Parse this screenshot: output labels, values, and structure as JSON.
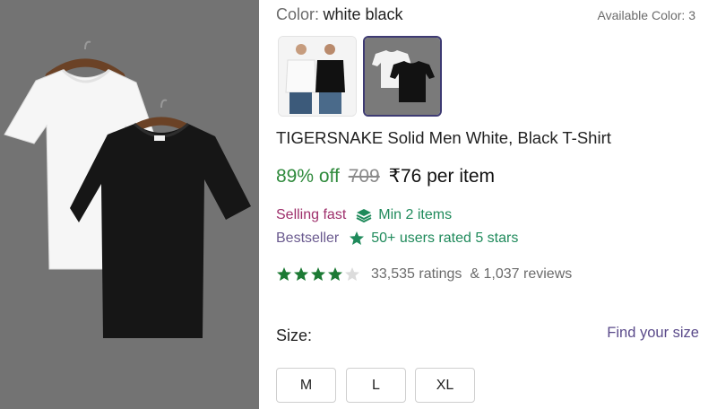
{
  "product": {
    "color_label": "Color:",
    "color_value": "white black",
    "available_colors": "Available Color: 3",
    "title": "TIGERSNAKE Solid Men White, Black T-Shirt",
    "discount": "89% off",
    "mrp": "709",
    "price": "₹76 per item",
    "selling_fast": "Selling fast",
    "min_items": "Min 2 items",
    "bestseller": "Bestseller",
    "users_rated": "50+ users rated 5 stars",
    "rating_value": 4,
    "rating_max": 5,
    "ratings_count": "33,535 ratings",
    "reviews_count": "& 1,037 reviews"
  },
  "size": {
    "label": "Size:",
    "find_link": "Find your size",
    "options": [
      "M",
      "L",
      "XL"
    ]
  },
  "colors": {
    "discount_green": "#2f8a3c",
    "selling_pink": "#9e2f6b",
    "bestseller_purple": "#6a5a8f",
    "badge_green": "#1f8a5b",
    "link_purple": "#5a4a8a",
    "star_green": "#1c7a34",
    "selected_border": "#3e3b73"
  },
  "icons": {
    "min_items": "stack-layers-icon",
    "users_rated": "star-badge-icon",
    "rating": "star-icon"
  }
}
